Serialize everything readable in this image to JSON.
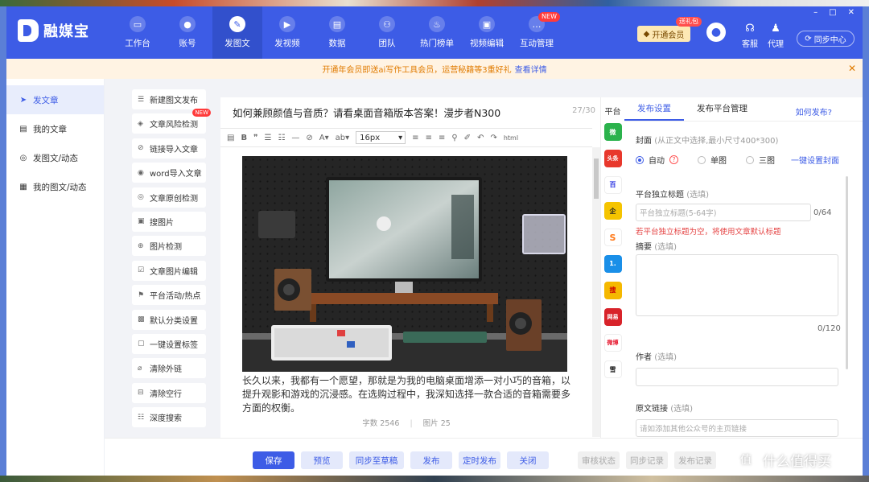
{
  "window": {
    "controls": [
      "–",
      "□",
      "✕"
    ]
  },
  "header": {
    "logo_text": "融媒宝",
    "nav": [
      {
        "label": "工作台",
        "icon": "monitor-icon"
      },
      {
        "label": "账号",
        "icon": "user-icon"
      },
      {
        "label": "发图文",
        "icon": "pen-icon",
        "active": true
      },
      {
        "label": "发视频",
        "icon": "video-icon"
      },
      {
        "label": "数据",
        "icon": "chart-icon"
      },
      {
        "label": "团队",
        "icon": "team-icon"
      },
      {
        "label": "热门榜单",
        "icon": "fire-icon"
      },
      {
        "label": "视频编辑",
        "icon": "briefcase-icon"
      },
      {
        "label": "互动管理",
        "icon": "chat-icon",
        "badge": "NEW"
      }
    ],
    "vip_label": "开通会员",
    "vip_badge": "送礼包",
    "support_label": "客服",
    "agent_label": "代理",
    "sync_label": "同步中心"
  },
  "notice": {
    "text": "开通年会员即送ai写作工具会员，运营秘籍等3重好礼",
    "link": "查看详情",
    "close": "✕"
  },
  "sidebar": {
    "items": [
      {
        "label": "发文章",
        "icon": "send-icon",
        "active": true
      },
      {
        "label": "我的文章",
        "icon": "doc-icon"
      },
      {
        "label": "发图文/动态",
        "icon": "circle-icon"
      },
      {
        "label": "我的图文/动态",
        "icon": "image-doc-icon"
      }
    ]
  },
  "tools": [
    {
      "label": "新建图文发布",
      "icon": "list-icon"
    },
    {
      "label": "文章风险检测",
      "icon": "shield-icon",
      "badge": "NEW"
    },
    {
      "label": "链接导入文章",
      "icon": "link-icon"
    },
    {
      "label": "word导入文章",
      "icon": "word-icon"
    },
    {
      "label": "文章原创检测",
      "icon": "check-icon"
    },
    {
      "label": "搜图片",
      "icon": "image-icon"
    },
    {
      "label": "图片检测",
      "icon": "search-icon"
    },
    {
      "label": "文章图片编辑",
      "icon": "edit-icon"
    },
    {
      "label": "平台活动/热点",
      "icon": "flag-icon"
    },
    {
      "label": "默认分类设置",
      "icon": "folder-icon"
    },
    {
      "label": "一键设置标签",
      "icon": "tag-icon"
    },
    {
      "label": "清除外链",
      "icon": "unlink-icon"
    },
    {
      "label": "清除空行",
      "icon": "clear-icon"
    },
    {
      "label": "深度搜索",
      "icon": "deep-search-icon"
    }
  ],
  "editor": {
    "title": "如何兼顾颜值与音质？请看桌面音箱版本答案！漫步者N300",
    "title_count": "27/30",
    "font_size": "16px",
    "toolbar_icons": [
      "source-icon",
      "bold-icon",
      "quote-icon",
      "ol-icon",
      "ul-icon",
      "hr-icon",
      "link-icon",
      "font-color-icon",
      "bg-color-icon",
      "align-left-icon",
      "align-center-icon",
      "align-right-icon",
      "find-icon",
      "format-brush-icon",
      "undo-icon",
      "redo-icon",
      "html-icon"
    ],
    "body": "长久以来，我都有一个愿望，那就是为我的电脑桌面增添一对小巧的音箱，以提升观影和游戏的沉浸感。在选购过程中，我深知选择一款合适的音箱需要多方面的权衡。",
    "word_count": "字数 2546",
    "image_count": "图片 25"
  },
  "platforms": {
    "header": "平台",
    "items": [
      {
        "name": "wechat",
        "label": "微",
        "color": "#2bb24c"
      },
      {
        "name": "toutiao",
        "label": "头条",
        "color": "#e8382c"
      },
      {
        "name": "baidu",
        "label": "百",
        "color": "#ffffff"
      },
      {
        "name": "penguin",
        "label": "企",
        "color": "#f5c400"
      },
      {
        "name": "sohu",
        "label": "S",
        "color": "#ff7a1a"
      },
      {
        "name": "one",
        "label": "1.",
        "color": "#1a8fe8"
      },
      {
        "name": "souhu-news",
        "label": "搜",
        "color": "#f5b800"
      },
      {
        "name": "netease",
        "label": "网易",
        "color": "#d8232a"
      },
      {
        "name": "weibo",
        "label": "微博",
        "color": "#e6162d"
      },
      {
        "name": "xueqiu",
        "label": "雪",
        "color": "#222222"
      }
    ]
  },
  "settings": {
    "tabs": [
      "发布设置",
      "发布平台管理"
    ],
    "help": "如何发布?",
    "cover_label": "封面",
    "cover_hint": "(从正文中选择,最小尺寸400*300)",
    "cover_options": [
      "自动",
      "单图",
      "三图"
    ],
    "cover_help": "?",
    "cover_link": "一键设置封面",
    "title_label": "平台独立标题",
    "title_optional": "(选填)",
    "title_placeholder": "平台独立标题(5-64字)",
    "title_count": "0/64",
    "title_tip": "若平台独立标题为空，将使用文章默认标题",
    "summary_label": "摘要",
    "summary_optional": "(选填)",
    "summary_count": "0/120",
    "author_label": "作者",
    "author_optional": "(选填)",
    "source_label": "原文链接",
    "source_optional": "(选填)",
    "source_placeholder": "请如添加其他公众号的主页链接"
  },
  "bottom": {
    "save": "保存",
    "preview": "预览",
    "sync_draft": "同步至草稿",
    "publish": "发布",
    "schedule": "定时发布",
    "close": "关闭",
    "review_status": "审核状态",
    "sync_record": "同步记录",
    "publish_record": "发布记录"
  },
  "watermark": {
    "text": "什么值得买",
    "mark": "值"
  },
  "colors": {
    "brand": "#3d5ce6",
    "notice_bg": "#fff3e3",
    "notice_text": "#e07b00",
    "danger": "#e54545"
  }
}
